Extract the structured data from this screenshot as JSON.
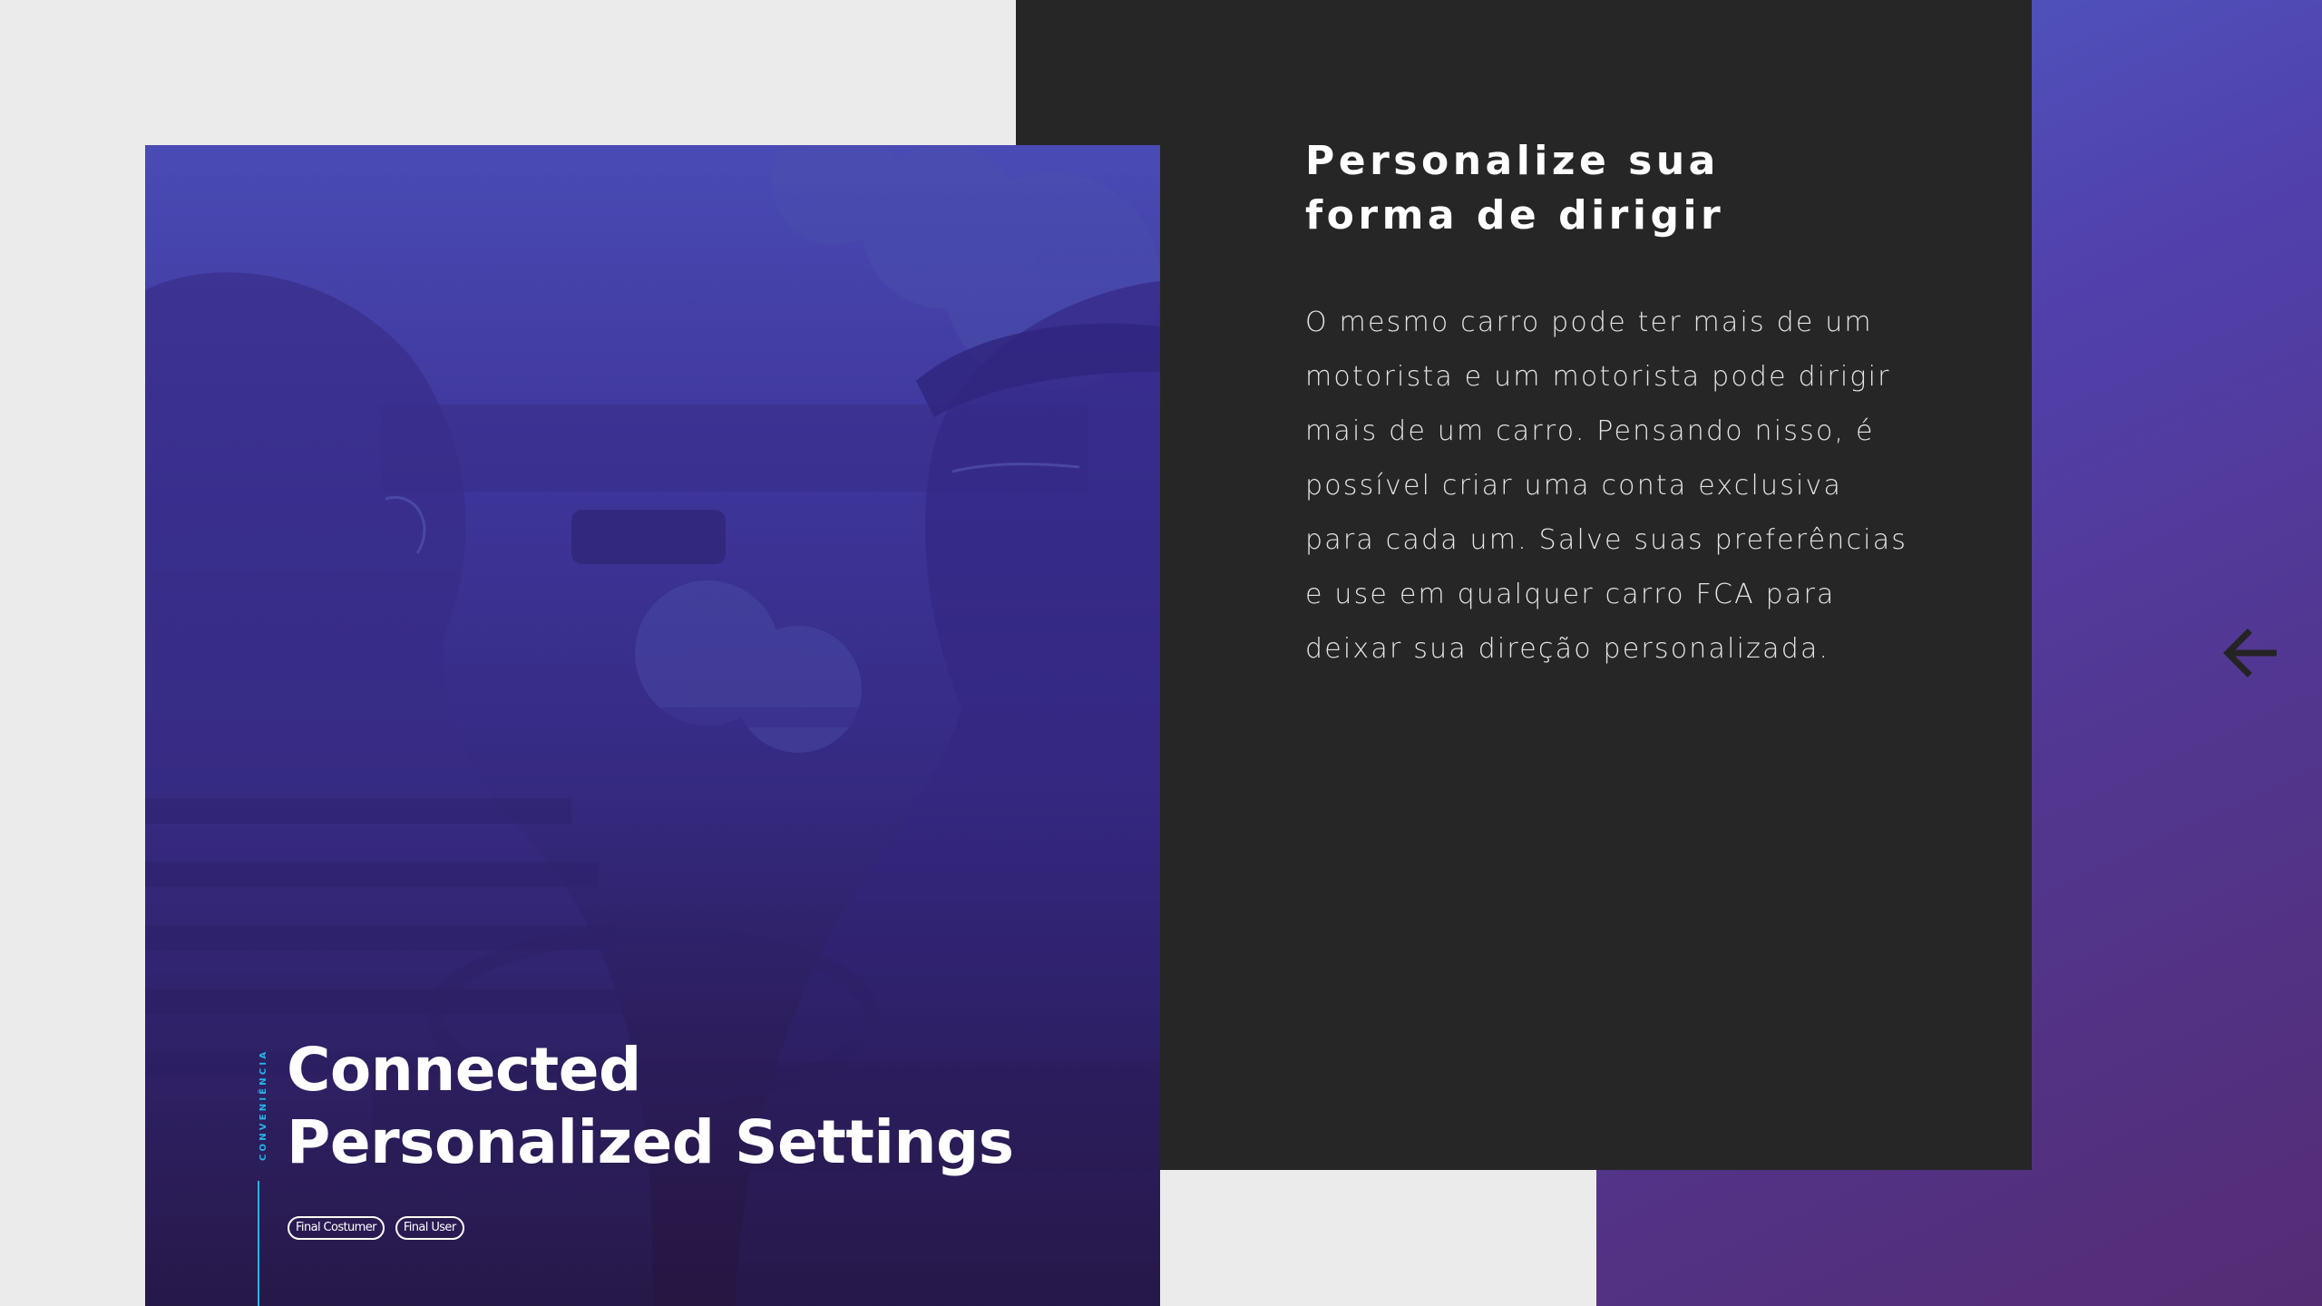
{
  "colors": {
    "page_background": "#ebebeb",
    "dark_card": "#262626",
    "accent": "#27b3ea",
    "gradient_start": "#4e5cc4",
    "gradient_end": "#542c74",
    "text_primary": "#ffffff"
  },
  "card": {
    "category_label": "CONVENIÊNCIA",
    "title_line1": "Connected",
    "title_line2": "Personalized Settings",
    "tags": [
      "Final Costumer",
      "Final User"
    ],
    "image_description": "two people inside a car"
  },
  "content": {
    "headline_line1": "Personalize sua",
    "headline_line2": "forma de dirigir",
    "body": "O mesmo carro pode ter mais de um\nmotorista e um motorista pode dirigir\nmais de um carro. Pensando nisso, é\npossível criar uma conta exclusiva\npara cada um. Salve suas preferências\ne use em qualquer carro FCA para\ndeixar sua direção personalizada."
  },
  "navigation": {
    "back_icon": "arrow-left-icon"
  }
}
